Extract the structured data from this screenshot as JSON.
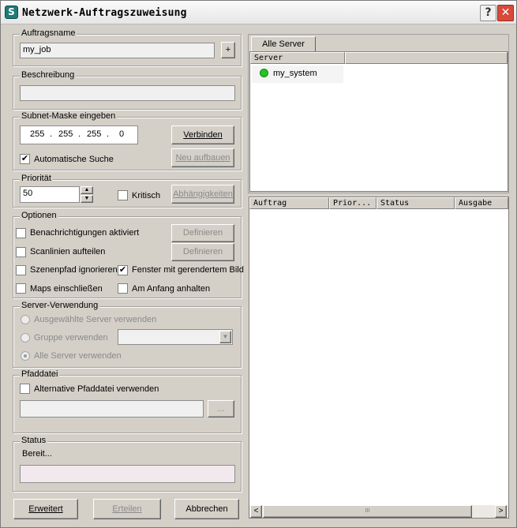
{
  "window": {
    "title": "Netzwerk-Auftragszuweisung",
    "help_label": "?",
    "close_label": "✕",
    "app_icon_letter": "S"
  },
  "job": {
    "group_label": "Auftragsname",
    "name_value": "my_job",
    "plus_label": "+"
  },
  "description": {
    "group_label": "Beschreibung",
    "value": ""
  },
  "subnet": {
    "group_label": "Subnet-Maske eingeben",
    "octets": [
      "255",
      "255",
      "255",
      "0"
    ],
    "dot": ".",
    "connect_label": "Verbinden",
    "auto_search_label": "Automatische Suche",
    "auto_search_checked": true,
    "rebuild_label": "Neu aufbauen"
  },
  "priority": {
    "group_label": "Priorität",
    "value": "50",
    "critical_label": "Kritisch",
    "critical_checked": false,
    "dependencies_label": "Abhängigkeiten"
  },
  "options": {
    "group_label": "Optionen",
    "notifications_label": "Benachrichtigungen aktiviert",
    "define_label_1": "Definieren",
    "split_scanlines_label": "Scanlinien aufteilen",
    "define_label_2": "Definieren",
    "ignore_scene_path_label": "Szenenpfad ignorieren",
    "render_window_label": "Fenster mit gerendertem Bild",
    "render_window_checked": true,
    "include_maps_label": "Maps einschließen",
    "halt_at_start_label": "Am Anfang anhalten"
  },
  "server_usage": {
    "group_label": "Server-Verwendung",
    "selected_servers_label": "Ausgewählte Server verwenden",
    "use_group_label": "Gruppe verwenden",
    "group_select_value": "",
    "all_servers_label": "Alle Server verwenden",
    "selected_option": "all"
  },
  "path_file": {
    "group_label": "Pfaddatei",
    "alt_path_label": "Alternative Pfaddatei verwenden",
    "path_value": "",
    "browse_label": "..."
  },
  "status": {
    "group_label": "Status",
    "text": "Bereit...",
    "bar_value": ""
  },
  "buttons": {
    "advanced_label": "Erweitert",
    "submit_label": "Erteilen",
    "cancel_label": "Abbrechen"
  },
  "server_panel": {
    "tab_label": "Alle Server",
    "column_server": "Server",
    "servers": [
      {
        "name": "my_system",
        "status_color": "#22c322"
      }
    ]
  },
  "queue_panel": {
    "columns": [
      "Auftrag",
      "Prior...",
      "Status",
      "Ausgabe"
    ],
    "rows": [],
    "scroll_thumb_glyph": "III",
    "scroll_left": "<",
    "scroll_right": ">"
  }
}
